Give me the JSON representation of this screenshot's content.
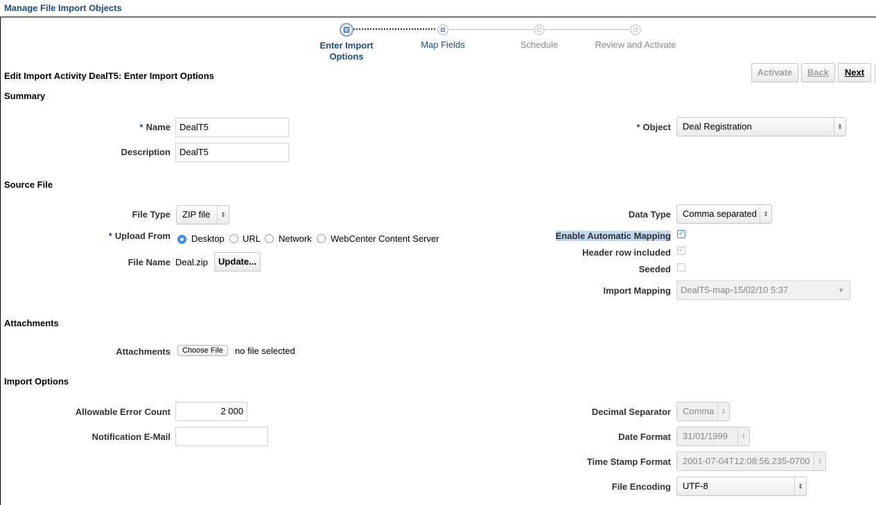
{
  "page": {
    "title": "Manage File Import Objects"
  },
  "train": {
    "steps": [
      {
        "label_line1": "Enter Import",
        "label_line2": "Options"
      },
      {
        "label": "Map Fields"
      },
      {
        "label": "Schedule"
      },
      {
        "label": "Review and Activate"
      }
    ]
  },
  "heading": "Edit Import Activity DealT5: Enter Import Options",
  "toolbar": {
    "activate": "Activate",
    "back": "Back",
    "next": "Next"
  },
  "summary": {
    "section": "Summary",
    "name_label": "Name",
    "name_value": "DealT5",
    "description_label": "Description",
    "description_value": "DealT5",
    "object_label": "Object",
    "object_value": "Deal Registration",
    "required_mark": "*"
  },
  "source_file": {
    "section": "Source File",
    "file_type_label": "File Type",
    "file_type_value": "ZIP file",
    "upload_from_label": "Upload From",
    "upload_options": [
      "Desktop",
      "URL",
      "Network",
      "WebCenter Content Server"
    ],
    "selected_upload": "Desktop",
    "file_name_label": "File Name",
    "file_name_value": "Deal.zip",
    "update_button": "Update...",
    "data_type_label": "Data Type",
    "data_type_value": "Comma separated",
    "auto_mapping_label": "Enable Automatic Mapping",
    "auto_mapping_checked": true,
    "header_row_label": "Header row included",
    "header_row_checked": true,
    "seeded_label": "Seeded",
    "seeded_checked": false,
    "import_mapping_label": "Import Mapping",
    "import_mapping_value": "DealT5-map-15/02/10 5:37"
  },
  "attachments": {
    "section": "Attachments",
    "label": "Attachments",
    "choose_button": "Choose File",
    "status": "no file selected"
  },
  "import_options": {
    "section": "Import Options",
    "error_count_label": "Allowable Error Count",
    "error_count_value": "2 000",
    "email_label": "Notification E-Mail",
    "email_value": "",
    "decimal_label": "Decimal Separator",
    "decimal_value": "Comma",
    "date_format_label": "Date Format",
    "date_format_value": "31/01/1999",
    "timestamp_label": "Time Stamp Format",
    "timestamp_value": "2001-07-04T12:08:56.235-0700",
    "encoding_label": "File Encoding",
    "encoding_value": "UTF-8"
  },
  "icons": {
    "select_arrow": "updown-arrow-icon",
    "dropdown_arrow": "chevron-down-icon",
    "check": "checkmark-icon"
  },
  "colors": {
    "link_blue": "#1a4f86",
    "radio_blue": "#3b8cf5",
    "highlight": "#bcd7f4"
  }
}
